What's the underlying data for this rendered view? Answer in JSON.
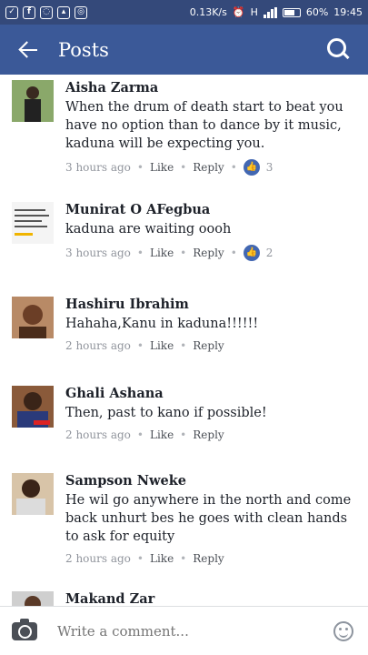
{
  "status_bar": {
    "speed": "0.13K/s",
    "network": "H",
    "battery": "60%",
    "time": "19:45"
  },
  "app_bar": {
    "title": "Posts"
  },
  "comments": [
    {
      "author": "Aisha Zarma",
      "text": "When the drum of death start to beat you have no option than to dance by it music, kaduna will be expecting you.",
      "time": "3 hours ago",
      "like_label": "Like",
      "reply_label": "Reply",
      "likes": "3"
    },
    {
      "author": "Munirat O AFegbua",
      "text": "kaduna are waiting  oooh",
      "time": "3 hours ago",
      "like_label": "Like",
      "reply_label": "Reply",
      "likes": "2"
    },
    {
      "author": "Hashiru Ibrahim",
      "text": "Hahaha,Kanu in kaduna!!!!!!",
      "time": "2 hours ago",
      "like_label": "Like",
      "reply_label": "Reply",
      "likes": ""
    },
    {
      "author": "Ghali Ashana",
      "text": "Then, past to kano if possible!",
      "time": "2 hours ago",
      "like_label": "Like",
      "reply_label": "Reply",
      "likes": ""
    },
    {
      "author": "Sampson Nweke",
      "text": "He wil go anywhere in the north and come back unhurt bes he goes with clean hands to ask for equity",
      "time": "2 hours ago",
      "like_label": "Like",
      "reply_label": "Reply",
      "likes": ""
    },
    {
      "author": "Makand Zar",
      "text": "",
      "time": "",
      "like_label": "",
      "reply_label": "",
      "likes": ""
    }
  ],
  "composer": {
    "placeholder": "Write a comment..."
  }
}
